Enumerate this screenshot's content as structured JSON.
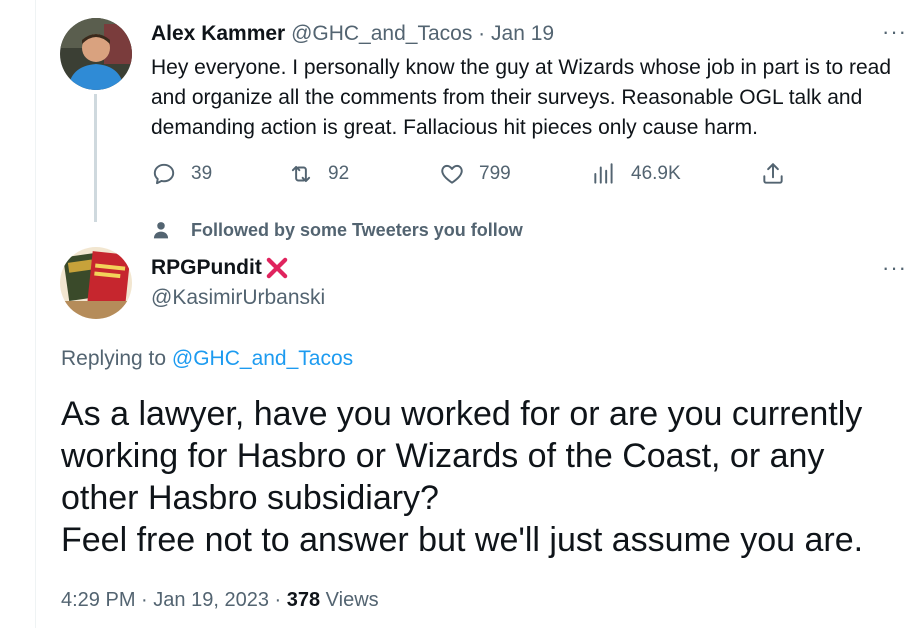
{
  "tweet1": {
    "name": "Alex Kammer",
    "handle": "@GHC_and_Tacos",
    "separator": "·",
    "date": "Jan 19",
    "body": "Hey everyone. I personally know the guy at Wizards whose job in part is to read and organize all the comments from their surveys. Reasonable OGL talk and demanding action is great. Fallacious hit pieces only cause harm.",
    "actions": {
      "replies": "39",
      "retweets": "92",
      "likes": "799",
      "views": "46.9K"
    },
    "icons": [
      "reply-icon",
      "retweet-icon",
      "like-icon",
      "views-icon",
      "share-icon",
      "more-icon"
    ]
  },
  "social_context": {
    "text": "Followed by some Tweeters you follow",
    "icon": "person-icon"
  },
  "tweet2": {
    "name": "RPGPundit",
    "badge_icon": "red-x-icon",
    "handle": "@KasimirUrbanski",
    "replying_prefix": "Replying to",
    "replying_handle": "@GHC_and_Tacos",
    "body_lines": [
      "As a lawyer, have you worked for or are you currently",
      "working for Hasbro or Wizards of the Coast, or any",
      "other Hasbro subsidiary?",
      "Feel free not to answer but we'll just assume you are."
    ],
    "time": "4:29 PM",
    "date": "Jan 19, 2023",
    "separator": "·",
    "views_count": "378",
    "views_label": "Views"
  },
  "colors": {
    "text": "#0f1419",
    "muted": "#536471",
    "link": "#1d9bf0",
    "thread_line": "#cfd9de",
    "badge_red": "#e0245e"
  }
}
